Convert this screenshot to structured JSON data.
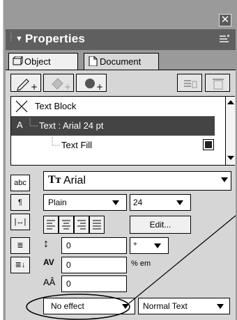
{
  "window": {
    "close_glyph": "✕"
  },
  "panel": {
    "title": "Properties",
    "title_icon": "collapse-triangle-icon",
    "menu_icon": "panel-menu-icon"
  },
  "tabs": [
    {
      "label": "Object",
      "icon": "object-icon",
      "active": true
    },
    {
      "label": "Document",
      "icon": "document-icon",
      "active": false
    }
  ],
  "tree": {
    "rows": [
      {
        "label": "Text Block",
        "icon": "x-mark-icon"
      },
      {
        "label": "Text : Arial 24 pt",
        "icon": "text-a-icon",
        "selected": true
      },
      {
        "label": "Text Fill",
        "icon": "fill-swatch-icon"
      }
    ]
  },
  "text_props": {
    "side_buttons": [
      "abc",
      "¶",
      "|↔|",
      "≣",
      "≣↓"
    ],
    "font": "Arial",
    "style": "Plain",
    "size": "24",
    "edit_label": "Edit...",
    "leading": "0",
    "leading_unit": "+",
    "tracking": "0",
    "tracking_unit": "% em",
    "baseline": "0",
    "effect": "No effect",
    "text_type": "Normal Text"
  },
  "colors": {
    "panel_bg": "#9a9a9a",
    "title_bg": "#5f5f5f",
    "selected_row": "#444444",
    "content_bg": "#d6d6d6"
  }
}
